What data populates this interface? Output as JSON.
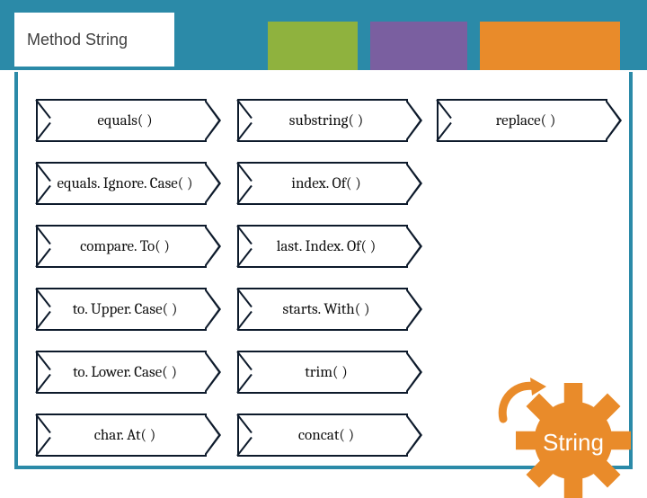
{
  "title": "Method String",
  "columns": [
    [
      "equals( )",
      "equals. Ignore. Case(  )",
      "compare. To( )",
      "to. Upper. Case( )",
      "to. Lower. Case( )",
      "char. At( )"
    ],
    [
      "substring( )",
      "index. Of( )",
      "last. Index. Of( )",
      "starts. With( )",
      "trim( )",
      "concat( )"
    ],
    [
      "replace( )"
    ]
  ],
  "gear": {
    "label": "String",
    "color": "#e98b2a"
  },
  "colors": {
    "teal": "#2b8aa8",
    "green": "#8fb23e",
    "purple": "#7a5fa0",
    "orange": "#e98b2a"
  }
}
